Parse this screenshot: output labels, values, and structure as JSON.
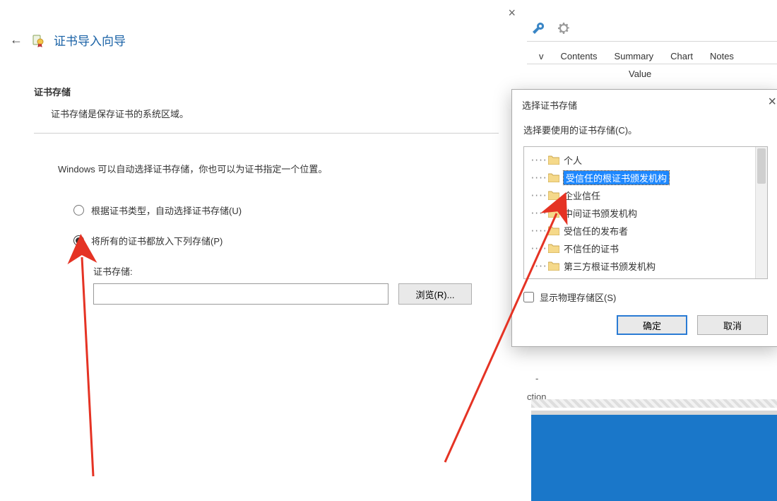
{
  "wizard": {
    "close_glyph": "×",
    "back_glyph": "←",
    "title": "证书导入向导",
    "section_label": "证书存储",
    "section_desc": "证书存储是保存证书的系统区域。",
    "auto_text": "Windows 可以自动选择证书存储，你也可以为证书指定一个位置。",
    "radio_auto": "根据证书类型，自动选择证书存储(U)",
    "radio_manual": "将所有的证书都放入下列存储(P)",
    "store_label": "证书存储:",
    "store_value": "",
    "browse_label": "浏览(R)..."
  },
  "right": {
    "tabs": [
      "Contents",
      "Summary",
      "Chart",
      "Notes"
    ],
    "tab_v_frag": "v",
    "value_header": "Value",
    "dash": "-",
    "ction": "ction"
  },
  "dialog": {
    "title": "选择证书存储",
    "close_glyph": "×",
    "prompt": "选择要使用的证书存储(C)。",
    "items": [
      {
        "label": "个人",
        "sel": false
      },
      {
        "label": "受信任的根证书颁发机构",
        "sel": true
      },
      {
        "label": "企业信任",
        "sel": false
      },
      {
        "label": "中间证书颁发机构",
        "sel": false
      },
      {
        "label": "受信任的发布者",
        "sel": false
      },
      {
        "label": "不信任的证书",
        "sel": false
      },
      {
        "label": "第三方根证书颁发机构",
        "sel": false
      }
    ],
    "checkbox_label": "显示物理存储区(S)",
    "ok_label": "确定",
    "cancel_label": "取消"
  },
  "icons": {
    "wrench": "wrench-icon",
    "gear": "gear-icon",
    "cert": "cert-wizard-icon"
  }
}
